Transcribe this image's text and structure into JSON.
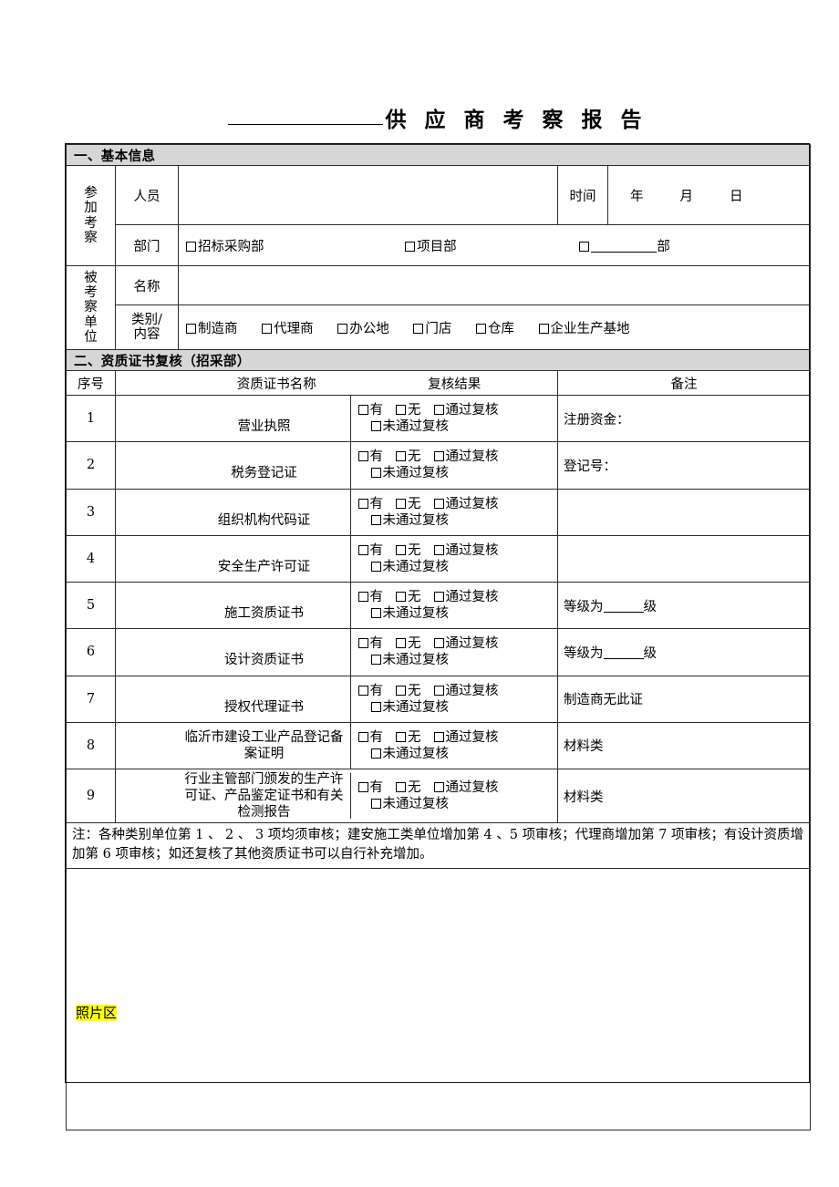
{
  "document": {
    "title_blank": "",
    "title": "供 应 商 考 察 报 告"
  },
  "section1": {
    "header": "一、基本信息",
    "participants_label": "参加考察",
    "personnel_label": "人员",
    "personnel_value": "",
    "time_label": "时间",
    "time_year": "年",
    "time_month": "月",
    "time_day": "日",
    "department_label": "部门",
    "department_options": [
      {
        "label": "招标采购部",
        "checked": false
      },
      {
        "label": "项目部",
        "checked": false
      },
      {
        "label": "部",
        "checked": false,
        "blank": true
      }
    ],
    "target_label": "被考察单位",
    "name_label": "名称",
    "name_value": "",
    "category_label": "类别/内容",
    "category_options": [
      {
        "label": "制造商",
        "checked": false
      },
      {
        "label": "代理商",
        "checked": false
      },
      {
        "label": "办公地",
        "checked": false
      },
      {
        "label": "门店",
        "checked": false
      },
      {
        "label": "仓库",
        "checked": false
      },
      {
        "label": "企业生产基地",
        "checked": false
      }
    ]
  },
  "section2": {
    "header": "二、资质证书复核（招采部）",
    "columns": [
      "序号",
      "资质证书名称",
      "复核结果",
      "备注"
    ],
    "result_options": [
      "有",
      "无",
      "通过复核",
      "未通过复核"
    ],
    "rows": [
      {
        "no": "1",
        "name": "营业执照",
        "remark": "注册资金：",
        "remark_blank": false
      },
      {
        "no": "2",
        "name": "税务登记证",
        "remark": "登记号：",
        "remark_blank": false
      },
      {
        "no": "3",
        "name": "组织机构代码证",
        "remark": "",
        "remark_blank": false
      },
      {
        "no": "4",
        "name": "安全生产许可证",
        "remark": "",
        "remark_blank": false
      },
      {
        "no": "5",
        "name": "施工资质证书",
        "remark_prefix": "等级为",
        "remark_suffix": "级",
        "remark_blank": true
      },
      {
        "no": "6",
        "name": "设计资质证书",
        "remark_prefix": "等级为",
        "remark_suffix": "级",
        "remark_blank": true
      },
      {
        "no": "7",
        "name": "授权代理证书",
        "remark": "制造商无此证",
        "remark_blank": false
      },
      {
        "no": "8",
        "name": "临沂市建设工业产品登记备案证明",
        "remark": "材料类",
        "remark_blank": false
      },
      {
        "no": "9",
        "name": "行业主管部门颁发的生产许可证、产品鉴定证书和有关检测报告",
        "remark": "材料类",
        "remark_blank": false
      }
    ],
    "note": "注：各种类别单位第 1 、 2 、 3 项均须审核；建安施工类单位增加第 4 、5 项审核；代理商增加第 7 项审核；有设计资质增加第 6 项审核；如还复核了其他资质证书可以自行补充增加。"
  },
  "photo_area": {
    "label": "照片区",
    "highlight_color": "#ffff00",
    "content": ""
  },
  "colors": {
    "section_header_bg": "#d6d6d6",
    "border": "#2b2b2b",
    "highlight": "#ffff00"
  }
}
